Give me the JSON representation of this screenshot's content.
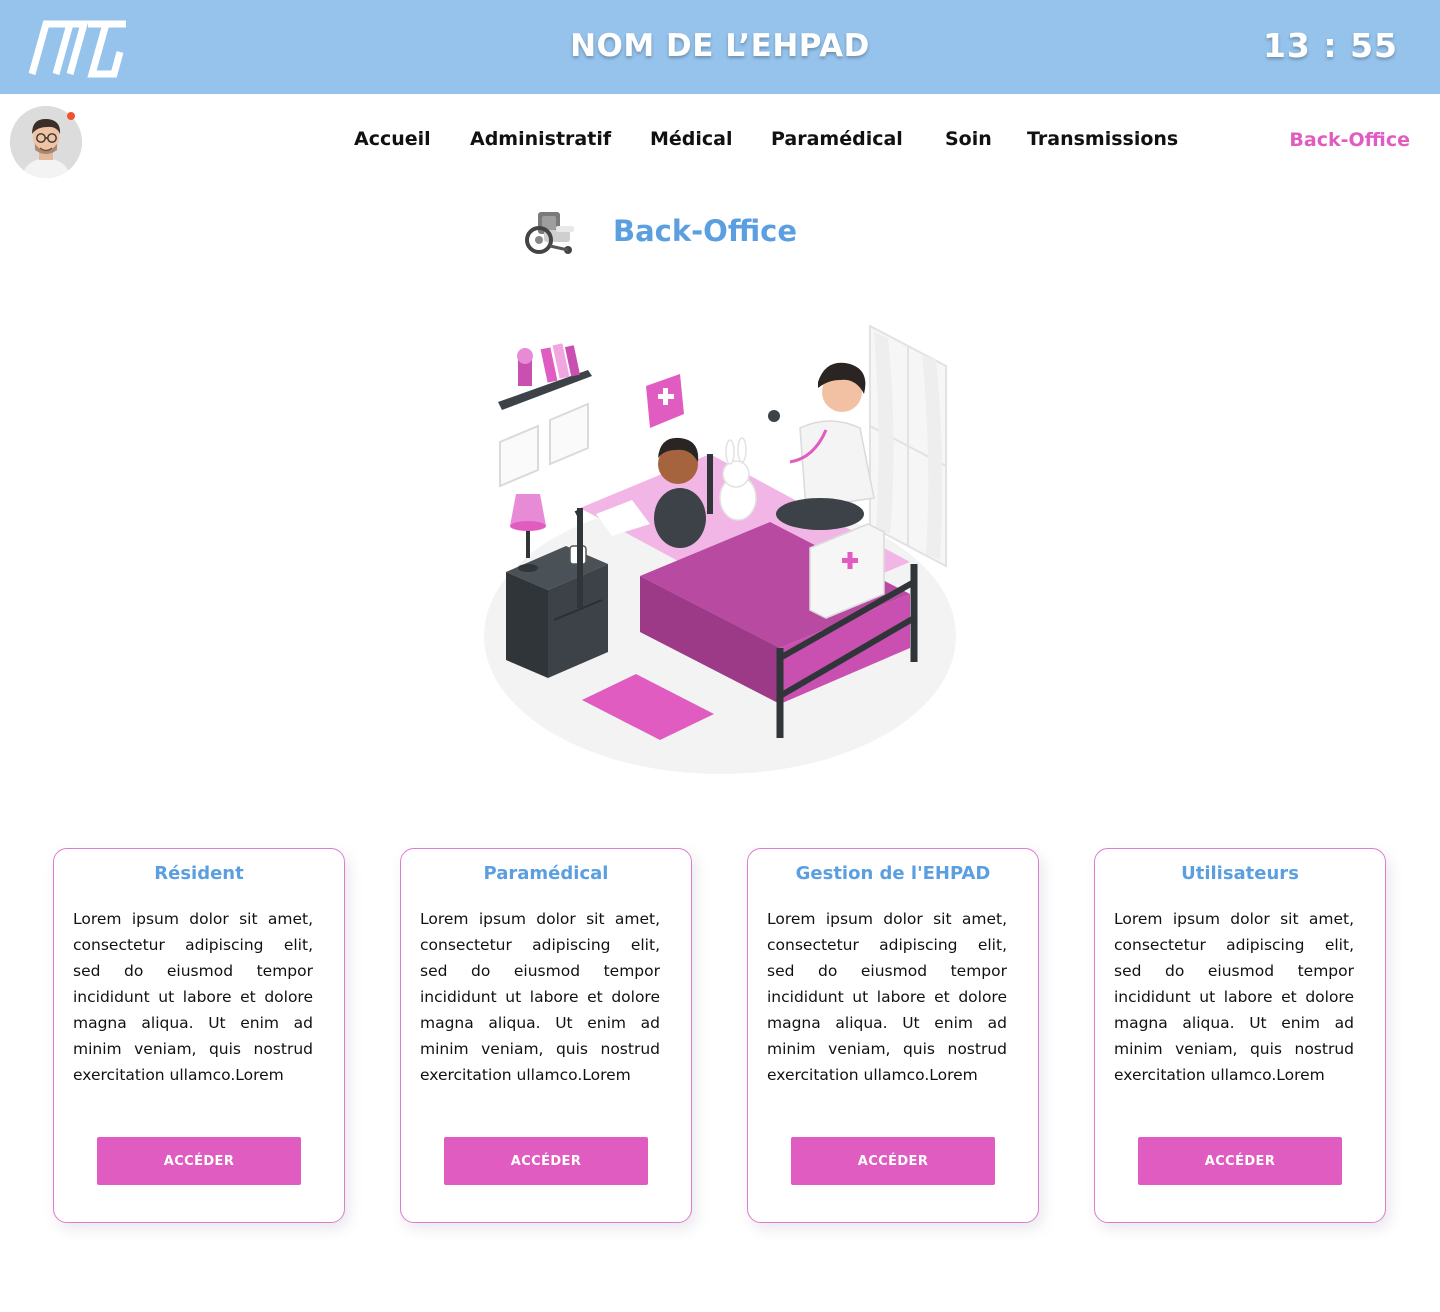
{
  "header": {
    "app_title": "NOM DE L’EHPAD",
    "clock": "13 : 55",
    "logo_icon": "mlt-logo-icon"
  },
  "nav": {
    "items": [
      {
        "label": "Accueil"
      },
      {
        "label": "Administratif"
      },
      {
        "label": "Médical"
      },
      {
        "label": "Paramédical"
      },
      {
        "label": "Soin"
      },
      {
        "label": "Transmissions"
      }
    ],
    "active": {
      "label": "Back-Office"
    }
  },
  "section": {
    "title": "Back-Office",
    "icon": "wheelchair-icon"
  },
  "cards": [
    {
      "title": "Résident",
      "text": "Lorem ipsum dolor sit amet, consectetur adipiscing elit, sed do eiusmod tempor incididunt ut labore et dolore magna aliqua. Ut enim ad minim veniam, quis nostrud exercitation ullamco.Lorem",
      "button": "ACCÉDER"
    },
    {
      "title": "Paramédical",
      "text": "Lorem ipsum dolor sit amet, consectetur adipiscing elit, sed do eiusmod tempor incididunt ut labore et dolore magna aliqua. Ut enim ad minim veniam, quis nostrud exercitation ullamco.Lorem",
      "button": "ACCÉDER"
    },
    {
      "title": "Gestion de l'EHPAD",
      "text": "Lorem ipsum dolor sit amet, consectetur adipiscing elit, sed do eiusmod tempor incididunt ut labore et dolore magna aliqua. Ut enim ad minim veniam, quis nostrud exercitation ullamco.Lorem",
      "button": "ACCÉDER"
    },
    {
      "title": "Utilisateurs",
      "text": "Lorem ipsum dolor sit amet, consectetur adipiscing elit, sed do eiusmod tempor incididunt ut labore et dolore magna aliqua. Ut enim ad minim veniam, quis nostrud exercitation ullamco.Lorem",
      "button": "ACCÉDER"
    }
  ],
  "colors": {
    "header_bg": "#95c3ec",
    "accent_pink": "#e05cc0",
    "title_blue": "#5b9fe0",
    "notification_dot": "#f0532b"
  }
}
